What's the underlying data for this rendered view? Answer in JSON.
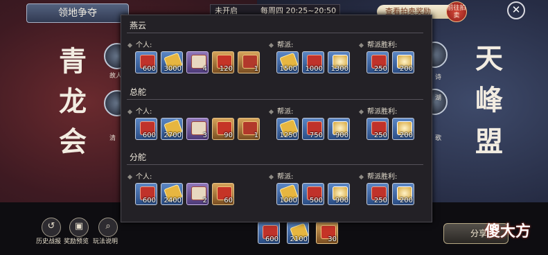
{
  "header": {
    "title": "领地争夺",
    "status": "未开启",
    "schedule": "每周四 20:25~20:50",
    "auction_button": "查看拍卖奖励",
    "goto_auction": "前往拍卖"
  },
  "guilds": {
    "left": "青龙会",
    "right": "天峰盟"
  },
  "side_labels": {
    "left_1": "故人",
    "left_2": "清",
    "right_1": "诗",
    "right_2": "湖",
    "right_3": "歌"
  },
  "bottom_buttons": {
    "history": "历史战报",
    "rewards": "奖励预览",
    "rules": "玩法说明"
  },
  "share_label": "分享",
  "watermark": "傻大方",
  "panel": {
    "sections": [
      {
        "name": "燕云",
        "personal_label": "个人:",
        "guild_label": "帮派:",
        "victory_label": "帮派胜利:",
        "personal": [
          {
            "icon": "red-book-icon",
            "count": "600"
          },
          {
            "icon": "gold-bar-icon",
            "count": "3000"
          },
          {
            "icon": "card-icon",
            "count": "4"
          },
          {
            "icon": "banner-box-icon",
            "count": "120"
          },
          {
            "icon": "treasure-box-icon",
            "count": "1"
          }
        ],
        "guild": [
          {
            "icon": "gold-bar-icon",
            "count": "1500"
          },
          {
            "icon": "red-book-icon",
            "count": "1000"
          },
          {
            "icon": "coin-icon",
            "count": "1300"
          }
        ],
        "victory": [
          {
            "icon": "red-book-icon",
            "count": "250"
          },
          {
            "icon": "coin-icon",
            "count": "200"
          }
        ]
      },
      {
        "name": "总舵",
        "personal_label": "个人:",
        "guild_label": "帮派:",
        "victory_label": "帮派胜利:",
        "personal": [
          {
            "icon": "red-book-icon",
            "count": "600"
          },
          {
            "icon": "gold-bar-icon",
            "count": "2700"
          },
          {
            "icon": "card-icon",
            "count": "3"
          },
          {
            "icon": "banner-box-icon",
            "count": "90"
          },
          {
            "icon": "treasure-box-icon",
            "count": "1"
          }
        ],
        "guild": [
          {
            "icon": "gold-bar-icon",
            "count": "1250"
          },
          {
            "icon": "red-book-icon",
            "count": "750"
          },
          {
            "icon": "coin-icon",
            "count": "900"
          }
        ],
        "victory": [
          {
            "icon": "red-book-icon",
            "count": "250"
          },
          {
            "icon": "coin-icon",
            "count": "200"
          }
        ]
      },
      {
        "name": "分舵",
        "personal_label": "个人:",
        "guild_label": "帮派:",
        "victory_label": "帮派胜利:",
        "personal": [
          {
            "icon": "red-book-icon",
            "count": "600"
          },
          {
            "icon": "gold-bar-icon",
            "count": "2400"
          },
          {
            "icon": "card-icon",
            "count": "2"
          },
          {
            "icon": "banner-box-icon",
            "count": "60"
          }
        ],
        "guild": [
          {
            "icon": "gold-bar-icon",
            "count": "1000"
          },
          {
            "icon": "red-book-icon",
            "count": "500"
          },
          {
            "icon": "coin-icon",
            "count": "900"
          }
        ],
        "victory": [
          {
            "icon": "red-book-icon",
            "count": "250"
          },
          {
            "icon": "coin-icon",
            "count": "200"
          }
        ]
      }
    ]
  },
  "bottom_rewards": [
    {
      "icon": "red-book-icon",
      "count": "600"
    },
    {
      "icon": "gold-bar-icon",
      "count": "2100"
    },
    {
      "icon": "banner-box-icon",
      "count": "30"
    }
  ]
}
